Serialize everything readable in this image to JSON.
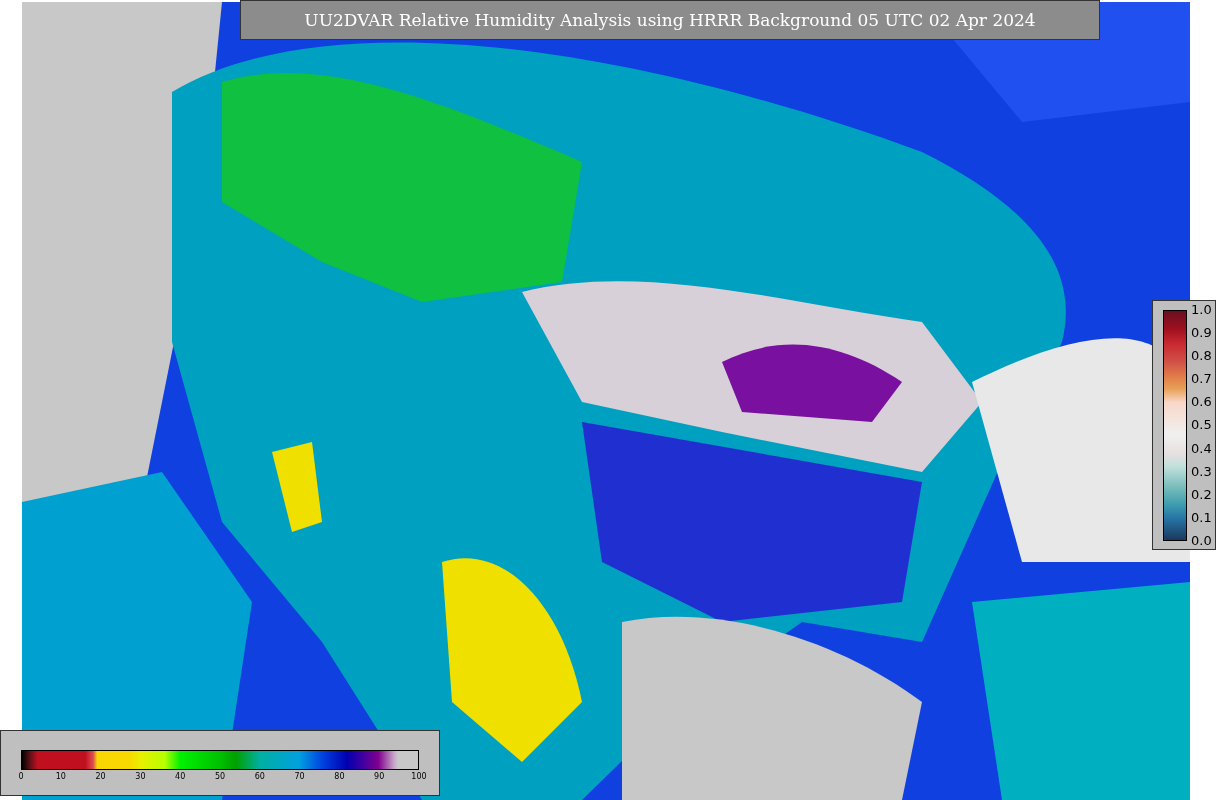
{
  "title": "UU2DVAR Relative Humidity Analysis using HRRR Background 05 UTC 02 Apr 2024",
  "humidity_legend": {
    "ticks": [
      "0",
      "10",
      "20",
      "30",
      "40",
      "50",
      "60",
      "70",
      "80",
      "90",
      "100"
    ]
  },
  "value_legend": {
    "ticks": [
      "1.0",
      "0.9",
      "0.8",
      "0.7",
      "0.6",
      "0.5",
      "0.4",
      "0.3",
      "0.2",
      "0.1",
      "0.0"
    ]
  }
}
